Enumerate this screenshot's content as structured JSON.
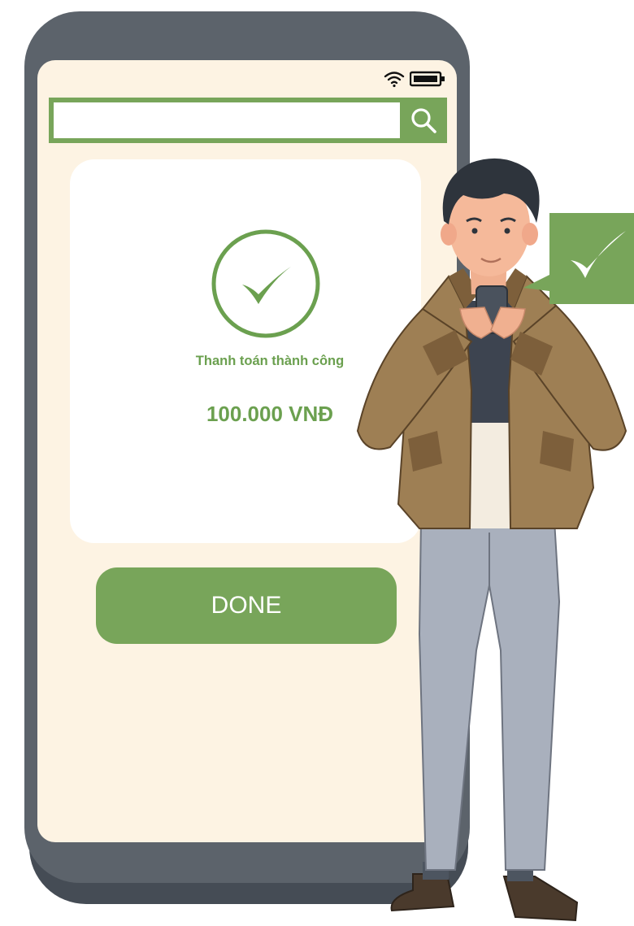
{
  "search": {
    "value": "",
    "placeholder": ""
  },
  "payment": {
    "status_text": "Thanh toán thành công",
    "amount": "100.000 VNĐ"
  },
  "done_button": {
    "label": "DONE"
  },
  "icons": {
    "status": [
      "wifi-icon",
      "battery-icon"
    ],
    "search": "search-icon",
    "success": "checkmark-circle-icon",
    "bubble": "checkmark-icon"
  },
  "colors": {
    "accent": "#78a55a",
    "accent_text": "#6ba04f",
    "screen_bg": "#fdf3e3",
    "phone_frame": "#5c636b",
    "card_bg": "#ffffff"
  }
}
